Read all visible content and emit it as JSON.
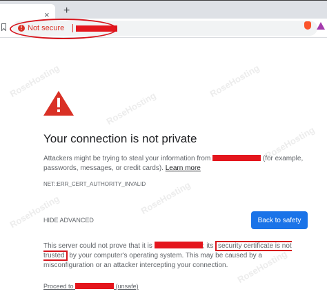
{
  "browser": {
    "tab_close_glyph": "×",
    "new_tab_glyph": "+",
    "security_label": "Not secure",
    "icons": [
      "bookmark-icon",
      "not-secure-icon",
      "brave-shields-icon",
      "brave-rewards-icon"
    ]
  },
  "page": {
    "title": "Your connection is not private",
    "description_pre": "Attackers might be trying to steal your information from",
    "description_post": "(for example, passwords, messages, or credit cards).",
    "learn_more": "Learn more",
    "error_code": "NET::ERR_CERT_AUTHORITY_INVALID",
    "advanced_button": "HIDE ADVANCED",
    "back_button": "Back to safety",
    "advanced_pre": "This server could not prove that it is",
    "advanced_its": "; its",
    "advanced_boxed": "security certificate is not trusted",
    "advanced_post": "by your computer's operating system. This may be caused by a misconfiguration or an attacker intercepting your connection.",
    "proceed_pre": "Proceed to",
    "proceed_post": "(unsafe)",
    "watermark_text": "RoseHosting"
  },
  "colors": {
    "error_red": "#d93025",
    "redaction": "#e4161d",
    "button_blue": "#1a73e8",
    "text_grey": "#5f6368"
  }
}
